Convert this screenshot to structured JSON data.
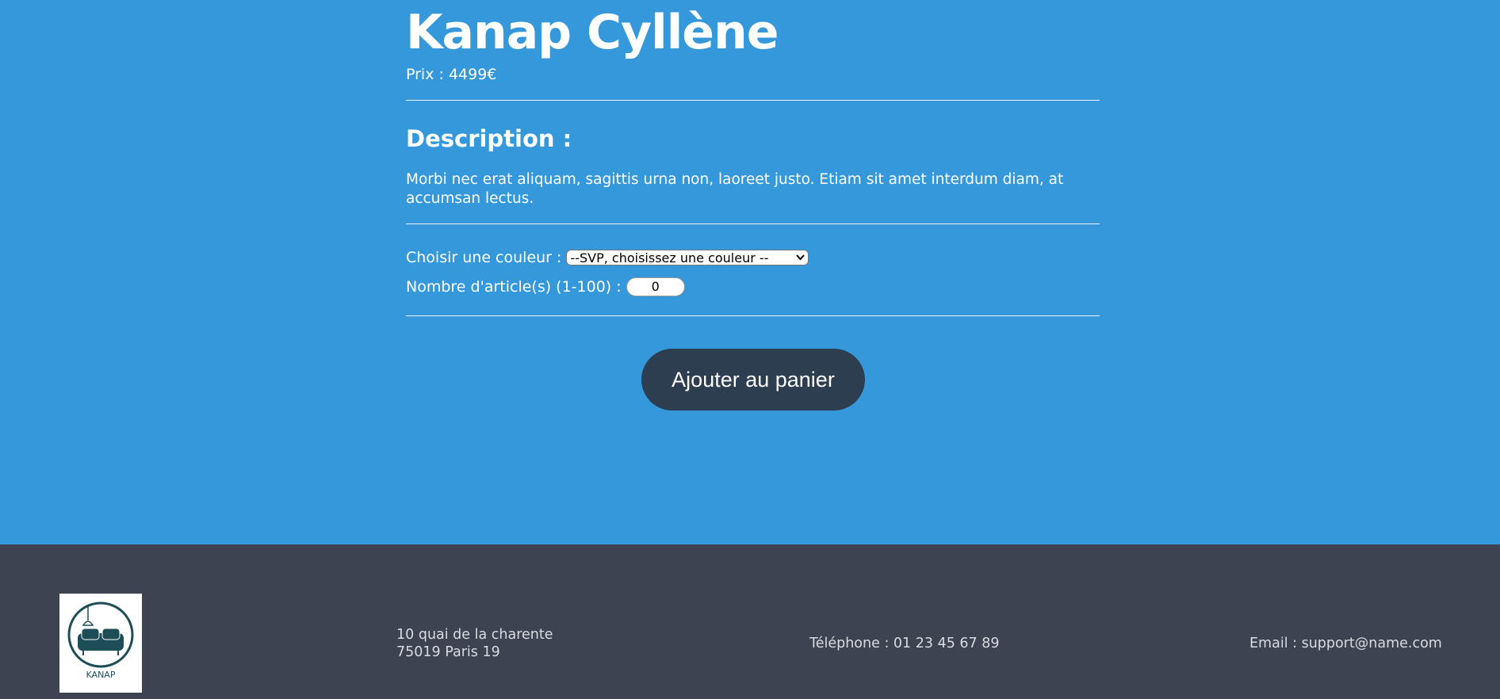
{
  "product": {
    "title": "Kanap Cyllène",
    "price_label": "Prix : 4499€",
    "description_title": "Description :",
    "description_text": "Morbi nec erat aliquam, sagittis urna non, laoreet justo. Etiam sit amet interdum diam, at accumsan lectus."
  },
  "options": {
    "color_label": "Choisir une couleur :",
    "color_selected": "--SVP, choisissez une couleur --",
    "quantity_label": "Nombre d'article(s) (1-100) :",
    "quantity_value": "0"
  },
  "cart": {
    "button_label": "Ajouter au panier"
  },
  "footer": {
    "logo_text": "KANAP",
    "address_line1": "10 quai de la charente",
    "address_line2": "75019 Paris 19",
    "phone": "Téléphone : 01 23 45 67 89",
    "email": "Email : support@name.com"
  },
  "colors": {
    "main_background": "#3498db",
    "button_background": "#2c3e50",
    "footer_background": "#3d4350",
    "logo_color": "#1d4e57"
  },
  "icons": {
    "logo": "sofa-lamp-logo-icon",
    "select_arrow": "chevron-down-icon"
  }
}
